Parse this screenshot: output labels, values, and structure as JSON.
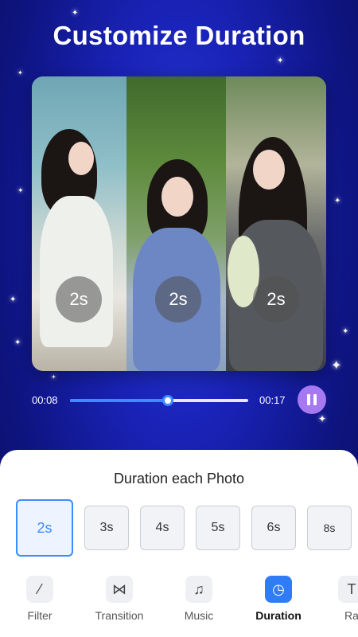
{
  "header": {
    "title": "Customize Duration"
  },
  "preview": {
    "photos": [
      {
        "duration": "2s"
      },
      {
        "duration": "2s"
      },
      {
        "duration": "2s"
      }
    ]
  },
  "playback": {
    "current_time": "00:08",
    "total_time": "00:17",
    "progress": 0.55,
    "state": "playing"
  },
  "duration_panel": {
    "title": "Duration each Photo",
    "options": [
      "2s",
      "3s",
      "4s",
      "5s",
      "6s",
      "8s"
    ],
    "selected": "2s"
  },
  "bottom_tabs": [
    {
      "label": "Filter",
      "icon": "magic-wand-icon"
    },
    {
      "label": "Transition",
      "icon": "bowtie-icon"
    },
    {
      "label": "Music",
      "icon": "music-note-icon"
    },
    {
      "label": "Duration",
      "icon": "clock-icon",
      "active": true
    },
    {
      "label": "Ra",
      "icon": "text-icon"
    }
  ],
  "colors": {
    "accent": "#3d8cff",
    "pause_button": "#a779f0",
    "background": "#1a23b8"
  }
}
